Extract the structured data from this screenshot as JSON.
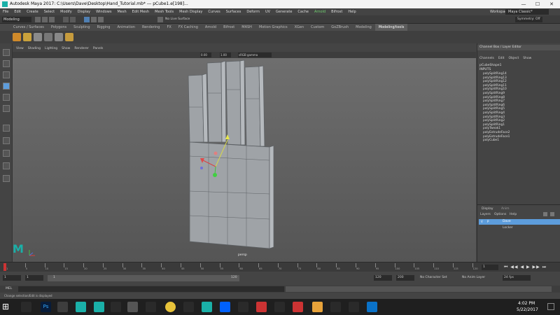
{
  "window": {
    "title": "Autodesk Maya 2017: C:\\Users\\Dave\\Desktop\\Hand_Tutorial.mb*  ---  pCube1.e[198]...",
    "min": "—",
    "max": "☐",
    "close": "✕"
  },
  "menubar": [
    "File",
    "Edit",
    "Create",
    "Select",
    "Modify",
    "Display",
    "Windows",
    "Mesh",
    "Edit Mesh",
    "Mesh Tools",
    "Mesh Display",
    "Curves",
    "Surfaces",
    "Deform",
    "UV",
    "Generate",
    "Cache",
    "Arnold",
    "Bifrost",
    "Help"
  ],
  "status_line": {
    "mode": "Modeling",
    "workspace_label": "Workspace:",
    "workspace_value": "Maya Classic*",
    "live_surface": "No Live Surface",
    "symmetry": "Symmetry: Off"
  },
  "shelf_tabs": [
    "Curves / Surfaces",
    "Polygons",
    "Sculpting",
    "Rigging",
    "Animation",
    "Rendering",
    "FX",
    "FX Caching",
    "Arnold",
    "Bifrost",
    "MASH",
    "Motion Graphics",
    "XGen",
    "Custom",
    "GoZBrush",
    "Modeling",
    "Modeling/tools"
  ],
  "shelf_active_tab": "Modeling/tools",
  "panel_menu": [
    "View",
    "Shading",
    "Lighting",
    "Show",
    "Renderer",
    "Panels"
  ],
  "panel_bar": {
    "field1": "0.00",
    "field2": "1.00",
    "colorspace": "sRGB gamma"
  },
  "viewport": {
    "camera_label": "persp"
  },
  "channel_box": {
    "title": "Channel Box / Layer Editor",
    "menu": [
      "Channels",
      "Edit",
      "Object",
      "Show"
    ],
    "object": "pCubeShape1",
    "inputs_label": "INPUTS",
    "history": [
      "polySplitRing14",
      "polySplitRing13",
      "polySplitRing12",
      "polySplitRing11",
      "polySplitRing10",
      "polySplitRing9",
      "polySplitRing8",
      "polySplitRing7",
      "polySplitRing6",
      "polySplitRing5",
      "polySplitRing4",
      "polySplitRing3",
      "polySplitRing2",
      "polySplitRing1",
      "polyTweak1",
      "polyExtrudeFace2",
      "polyExtrudeFace1",
      "polyCube1"
    ]
  },
  "layer_editor": {
    "tabs": [
      "Display",
      "Anim"
    ],
    "menu": [
      "Layers",
      "Options",
      "Help"
    ],
    "layers": [
      {
        "v": "V",
        "p": "P",
        "name": "Dave"
      },
      {
        "v": "",
        "p": "",
        "name": "Locker"
      }
    ]
  },
  "time_slider": {
    "ticks": [
      "1",
      "5",
      "10",
      "15",
      "20",
      "25",
      "30",
      "35",
      "40",
      "45",
      "50",
      "55",
      "60",
      "65",
      "70",
      "75",
      "80",
      "85",
      "90",
      "95",
      "100",
      "105",
      "110",
      "115",
      "120"
    ],
    "current_frame": "1"
  },
  "range_slider": {
    "start": "1",
    "inner_start": "1",
    "range_in": "1",
    "range_out": "120",
    "end_a": "120",
    "end_b": "200",
    "character_set": "No Character Set",
    "anim_layer": "No Anim Layer",
    "fps": "24 fps"
  },
  "command_line": {
    "label": "MEL"
  },
  "help_line": {
    "text": "Change selection/Edit is displayed"
  },
  "taskbar": {
    "time": "4:02 PM",
    "date": "5/22/2017"
  },
  "colors": {
    "accent": "#5d9ddc",
    "viewport": "#666666",
    "mesh": "#9fa3a7",
    "maya_teal": "#1ab0a8"
  }
}
